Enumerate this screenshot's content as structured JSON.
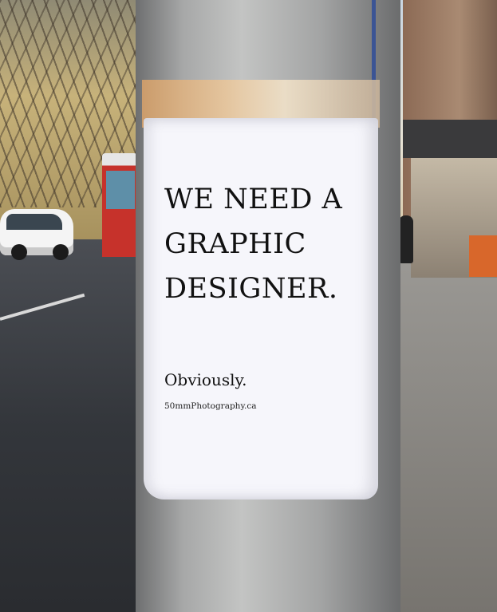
{
  "poster": {
    "headline": [
      "WE NEED A",
      "GRAPHIC",
      "DESIGNER."
    ],
    "tagline": "Obviously.",
    "credit": "50mmPhotography.ca"
  }
}
